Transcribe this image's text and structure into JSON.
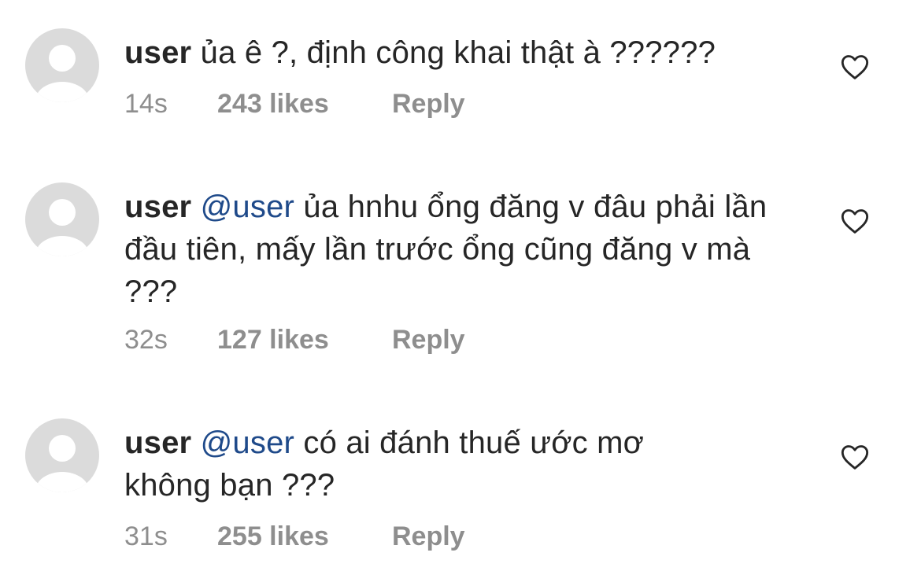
{
  "comments": [
    {
      "username": "user",
      "mention": "",
      "text": "ủa ê ?, định công khai thật à ??????",
      "time": "14s",
      "likes": "243 likes",
      "reply": "Reply",
      "like_icon": "heart-outline-icon"
    },
    {
      "username": "user",
      "mention": "@user",
      "text": "ủa hnhu ổng đăng v đâu phải lần đầu tiên, mấy lần trước ổng cũng đăng v mà ???",
      "time": "32s",
      "likes": "127 likes",
      "reply": "Reply",
      "like_icon": "heart-outline-icon"
    },
    {
      "username": "user",
      "mention": "@user",
      "text": "có ai đánh thuế ước mơ không bạn ???",
      "time": "31s",
      "likes": "255 likes",
      "reply": "Reply",
      "like_icon": "heart-outline-icon"
    }
  ],
  "colors": {
    "text": "#262626",
    "meta": "#8e8e8e",
    "mention": "#1f4a8a",
    "avatar_bg": "#dbdbdb",
    "avatar_fg": "#ffffff"
  }
}
